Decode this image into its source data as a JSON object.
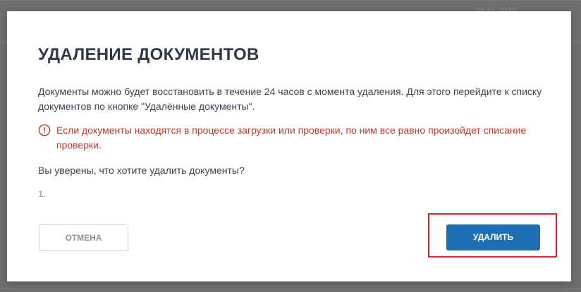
{
  "background": {
    "date_text": "24.11.2022"
  },
  "dialog": {
    "title": "УДАЛЕНИЕ ДОКУМЕНТОВ",
    "info": "Документы можно будет восстановить в течение 24 часов с момента удаления. Для этого перейдите к списку документов по кнопке \"Удалённые документы\".",
    "warning": "Если документы находятся в процессе загрузки или проверки, по ним все равно произойдет списание проверки.",
    "warning_icon": "info-circle-icon",
    "question": "Вы уверены, что хотите удалить документы?",
    "document_list": [
      "1."
    ],
    "cancel_label": "ОТМЕНА",
    "delete_label": "УДАЛИТЬ"
  },
  "colors": {
    "primary": "#1f6fb5",
    "warning": "#c0392b",
    "highlight": "#d9232e",
    "title": "#2e3a4a"
  }
}
